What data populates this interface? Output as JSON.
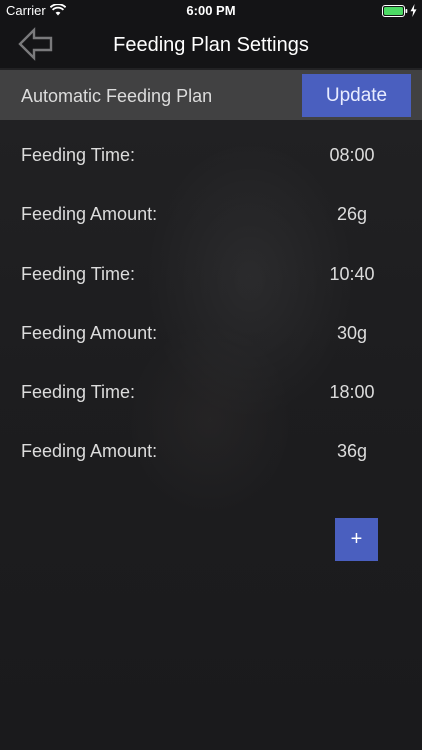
{
  "status_bar": {
    "carrier": "Carrier",
    "time": "6:00 PM",
    "battery_color": "#4cd964"
  },
  "nav": {
    "title": "Feeding Plan Settings",
    "back_icon": "back-arrow-icon"
  },
  "plan": {
    "label": "Automatic Feeding Plan",
    "update_label": "Update"
  },
  "rows": [
    {
      "label": "Feeding Time:",
      "value": "08:00"
    },
    {
      "label": "Feeding Amount:",
      "value": "26g"
    },
    {
      "label": "Feeding Time:",
      "value": "10:40"
    },
    {
      "label": "Feeding Amount:",
      "value": "30g"
    },
    {
      "label": "Feeding Time:",
      "value": "18:00"
    },
    {
      "label": "Feeding Amount:",
      "value": "36g"
    }
  ],
  "add_button": {
    "label": "+"
  },
  "colors": {
    "accent": "#4a5fbf",
    "background": "#1e1e20",
    "header_bar": "#414142"
  }
}
